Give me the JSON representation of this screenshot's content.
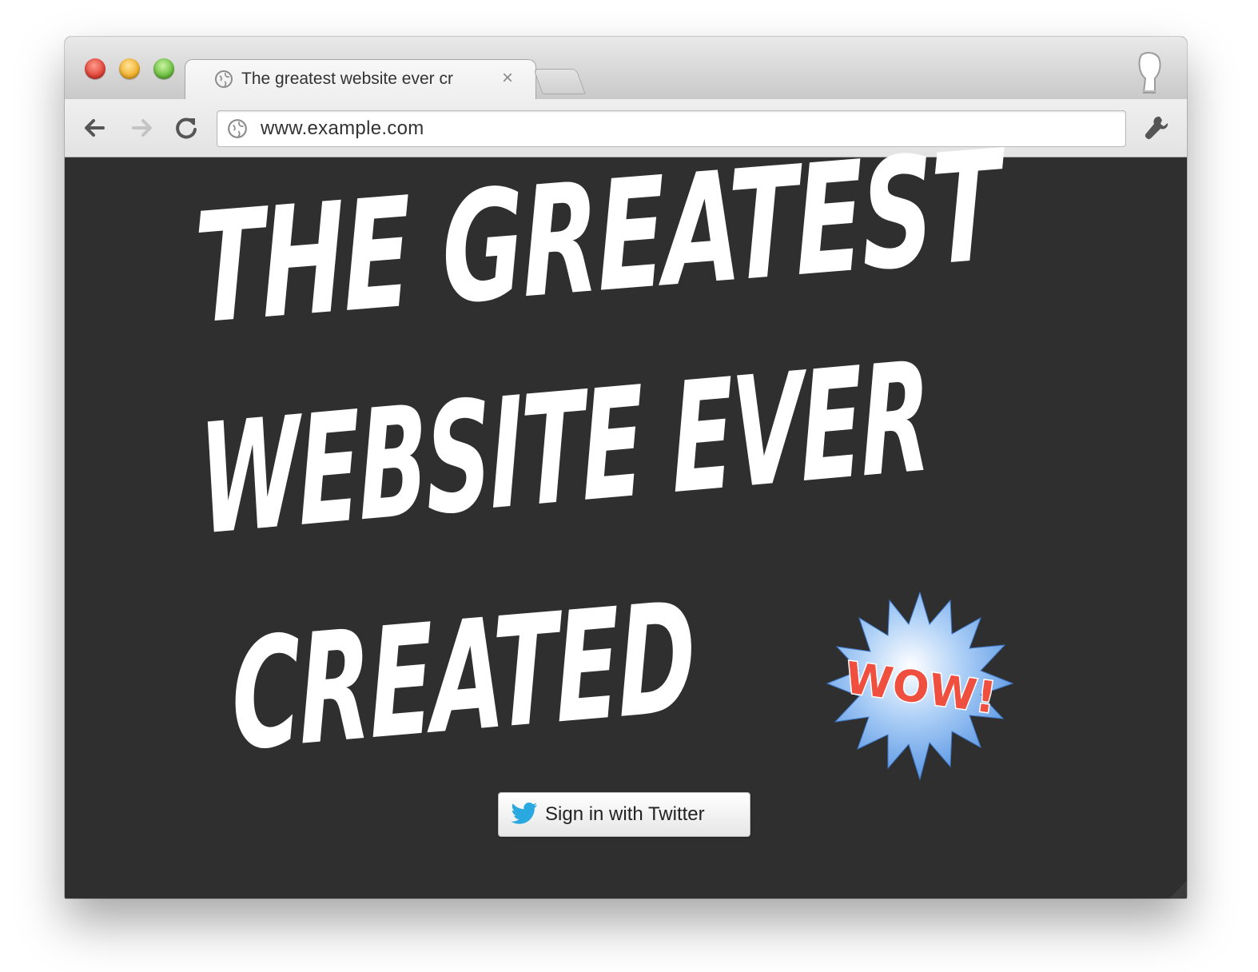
{
  "window": {
    "tab_title": "The greatest website ever cr",
    "tab_close_glyph": "×",
    "url": "www.example.com"
  },
  "page": {
    "headline_line1": "The Greatest",
    "headline_line2": "Website Ever",
    "headline_line3": "Created",
    "badge_text": "WOW!",
    "signin_label": "Sign in with Twitter"
  },
  "colors": {
    "page_background": "#2f2f2f",
    "headline": "#ffffff",
    "badge_fill": "#7fb2ee",
    "badge_text": "#ef4f3f",
    "twitter_blue": "#2aa9e0"
  },
  "icons": {
    "window_controls": [
      "close-icon",
      "minimize-icon",
      "maximize-icon"
    ],
    "tab_favicon": "globe-icon",
    "profile": "profile-icon",
    "back": "back-arrow-icon",
    "forward": "forward-arrow-icon",
    "reload": "reload-icon",
    "omnibox": "globe-icon",
    "menu": "wrench-icon",
    "twitter": "twitter-bird-icon"
  }
}
